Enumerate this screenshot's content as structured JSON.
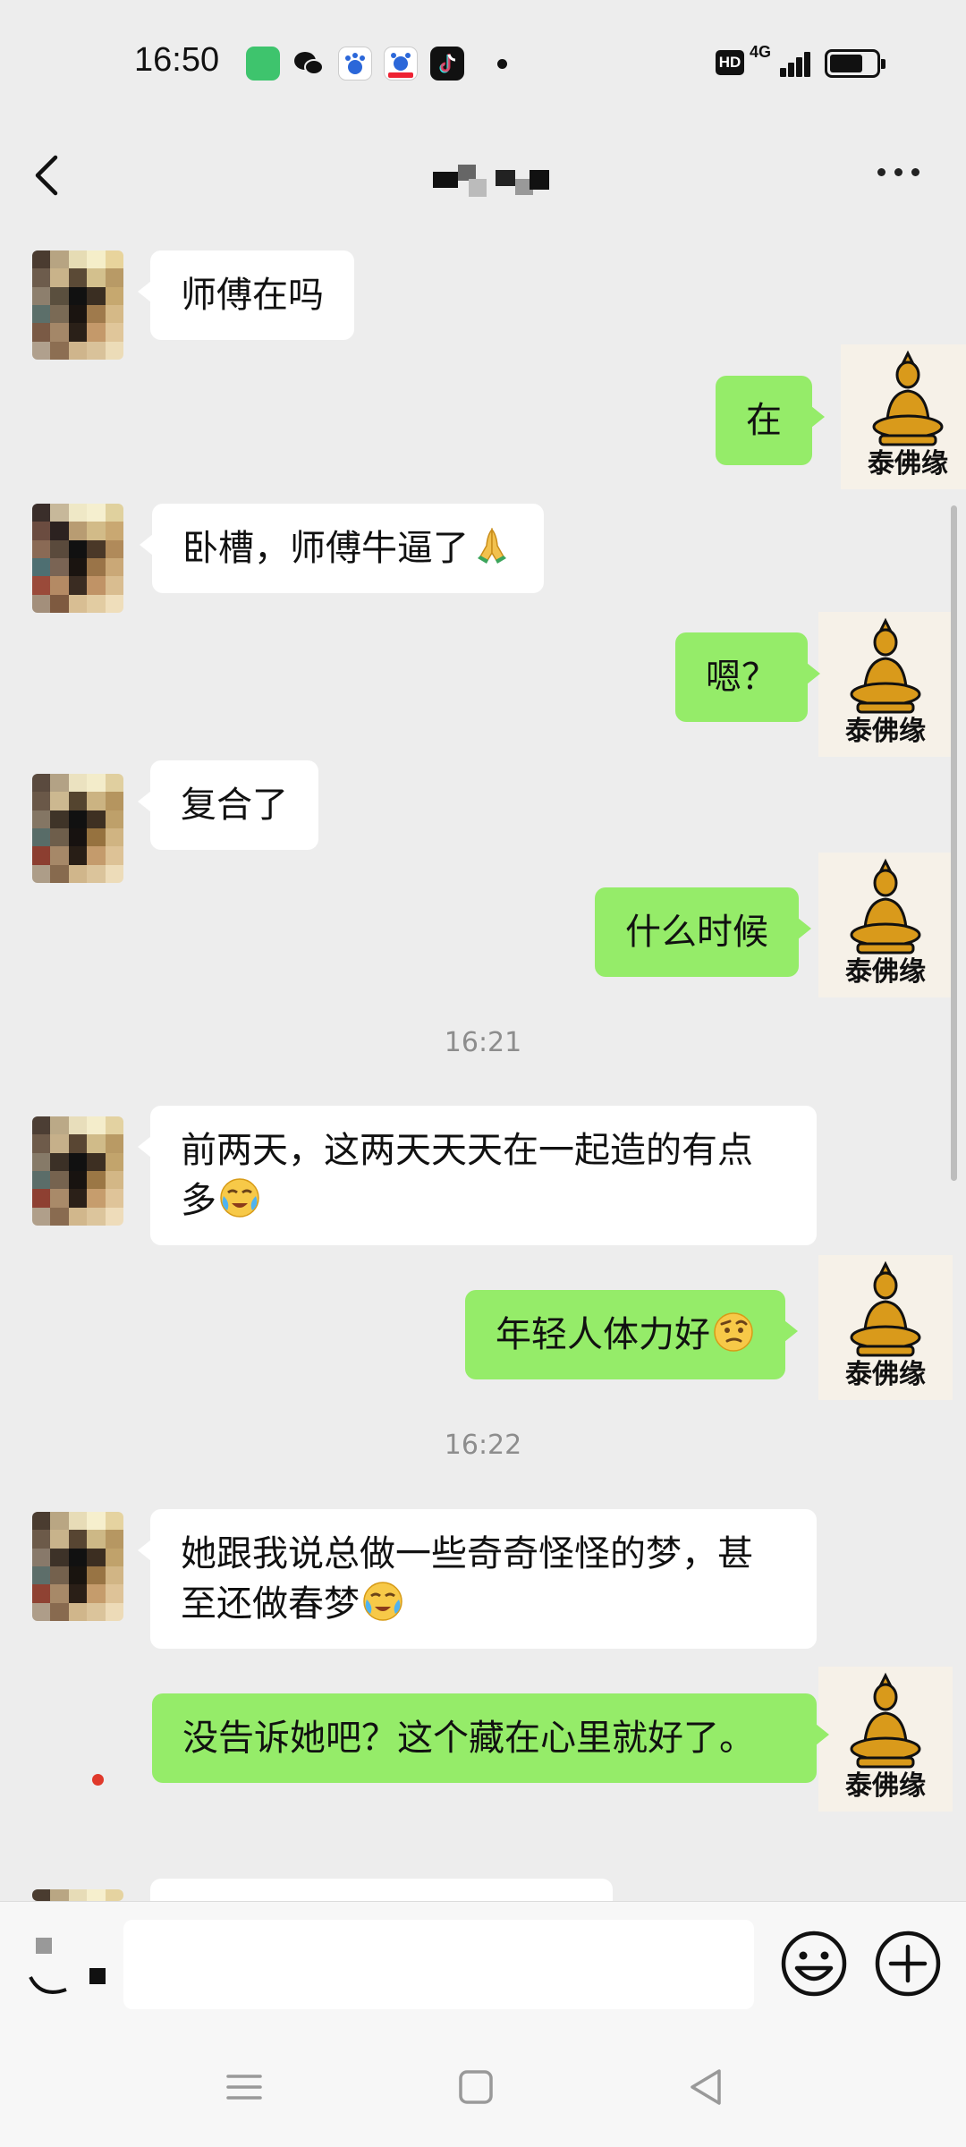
{
  "status_bar": {
    "time": "16:50",
    "network": "4G",
    "hd_badge": "HD",
    "app_icons": [
      "wechat-mini-program-icon",
      "wechat-icon",
      "baidu-icon",
      "baidu-red-icon",
      "tiktok-icon"
    ]
  },
  "header": {
    "back_icon": "chevron-left-icon",
    "contact_name": "",
    "more_icon": "more-dots-icon"
  },
  "messages": [
    {
      "side": "left",
      "text": "师傅在吗",
      "emoji": ""
    },
    {
      "side": "right",
      "text": "在",
      "emoji": ""
    },
    {
      "side": "left",
      "text": "卧槽，师傅牛逼了",
      "emoji": "🙏"
    },
    {
      "side": "right",
      "text": "嗯？",
      "emoji": ""
    },
    {
      "side": "left",
      "text": "复合了",
      "emoji": ""
    },
    {
      "side": "right",
      "text": "什么时候",
      "emoji": ""
    },
    {
      "side": "timestamp",
      "text": "16:21"
    },
    {
      "side": "left",
      "text": "前两天，这两天天天在一起造的有点多",
      "emoji": "😭"
    },
    {
      "side": "right",
      "text": "年轻人体力好",
      "emoji": "🤨"
    },
    {
      "side": "timestamp",
      "text": "16:22"
    },
    {
      "side": "left",
      "text": "她跟我说总做一些奇奇怪怪的梦，甚至还做春梦",
      "emoji": "😭"
    },
    {
      "side": "right",
      "text": "没告诉她吧？这个藏在心里就好了。",
      "emoji": ""
    }
  ],
  "my_avatar_label": "泰佛缘",
  "input_bar": {
    "voice_icon": "voice-icon",
    "emoji_icon": "smiley-icon",
    "plus_icon": "plus-circle-icon"
  },
  "nav_bar": {
    "icons": [
      "menu-icon",
      "home-square-icon",
      "back-triangle-icon"
    ]
  },
  "colors": {
    "background": "#ededed",
    "sent_bubble": "#95ec69",
    "received_bubble": "#ffffff",
    "timestamp_text": "#8d8d8d",
    "unread_dot": "#e0392b"
  }
}
